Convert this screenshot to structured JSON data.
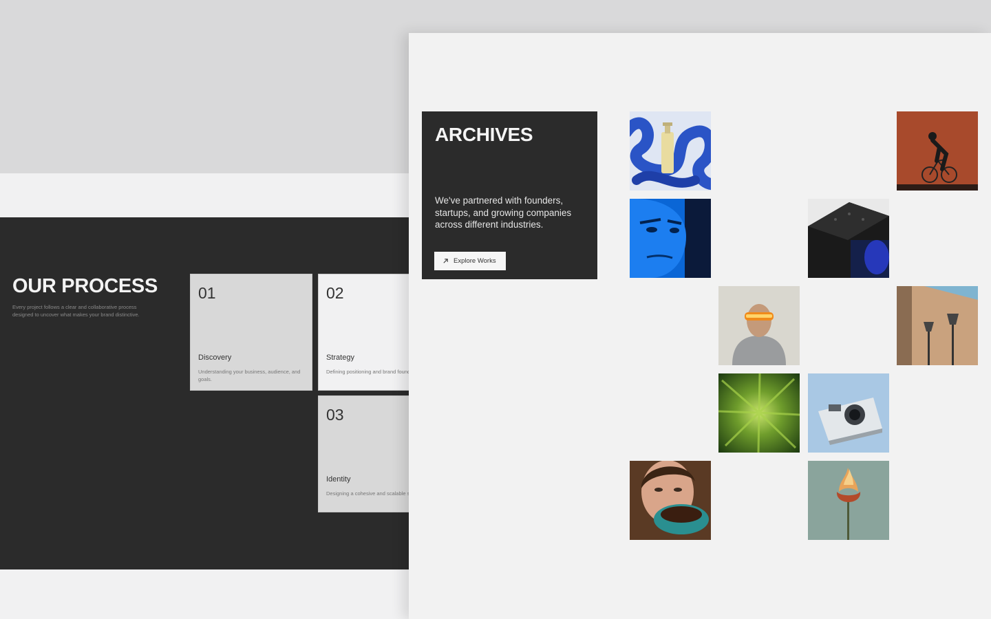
{
  "process": {
    "title": "OUR PROCESS",
    "description": "Every project follows a clear and collaborative process designed to uncover what makes your brand distinctive.",
    "steps": [
      {
        "number": "01",
        "title": "Discovery",
        "description": "Understanding your business, audience, and goals."
      },
      {
        "number": "02",
        "title": "Strategy",
        "description": "Defining positioning and brand foundations."
      },
      {
        "number": "03",
        "title": "Identity",
        "description": "Designing a cohesive and scalable system."
      }
    ]
  },
  "archives": {
    "title": "ARCHIVES",
    "description": "We've partnered with founders, startups, and growing companies across different industries.",
    "button_label": "Explore Works",
    "button_icon": "arrow-up-right-icon"
  },
  "gallery": [
    {
      "name": "blue-ribbon-bottle-image"
    },
    {
      "name": "cyclist-image"
    },
    {
      "name": "blue-face-portrait-image"
    },
    {
      "name": "black-device-image"
    },
    {
      "name": "hooded-figure-visor-image"
    },
    {
      "name": "street-lamps-wall-image"
    },
    {
      "name": "green-zoom-blur-image"
    },
    {
      "name": "instant-camera-image"
    },
    {
      "name": "woman-coffee-cup-image"
    },
    {
      "name": "burning-flower-image"
    }
  ],
  "colors": {
    "background": "#d9d9da",
    "dark": "#2b2b2b",
    "light": "#f2f2f2",
    "card": "#d8d8d8"
  }
}
